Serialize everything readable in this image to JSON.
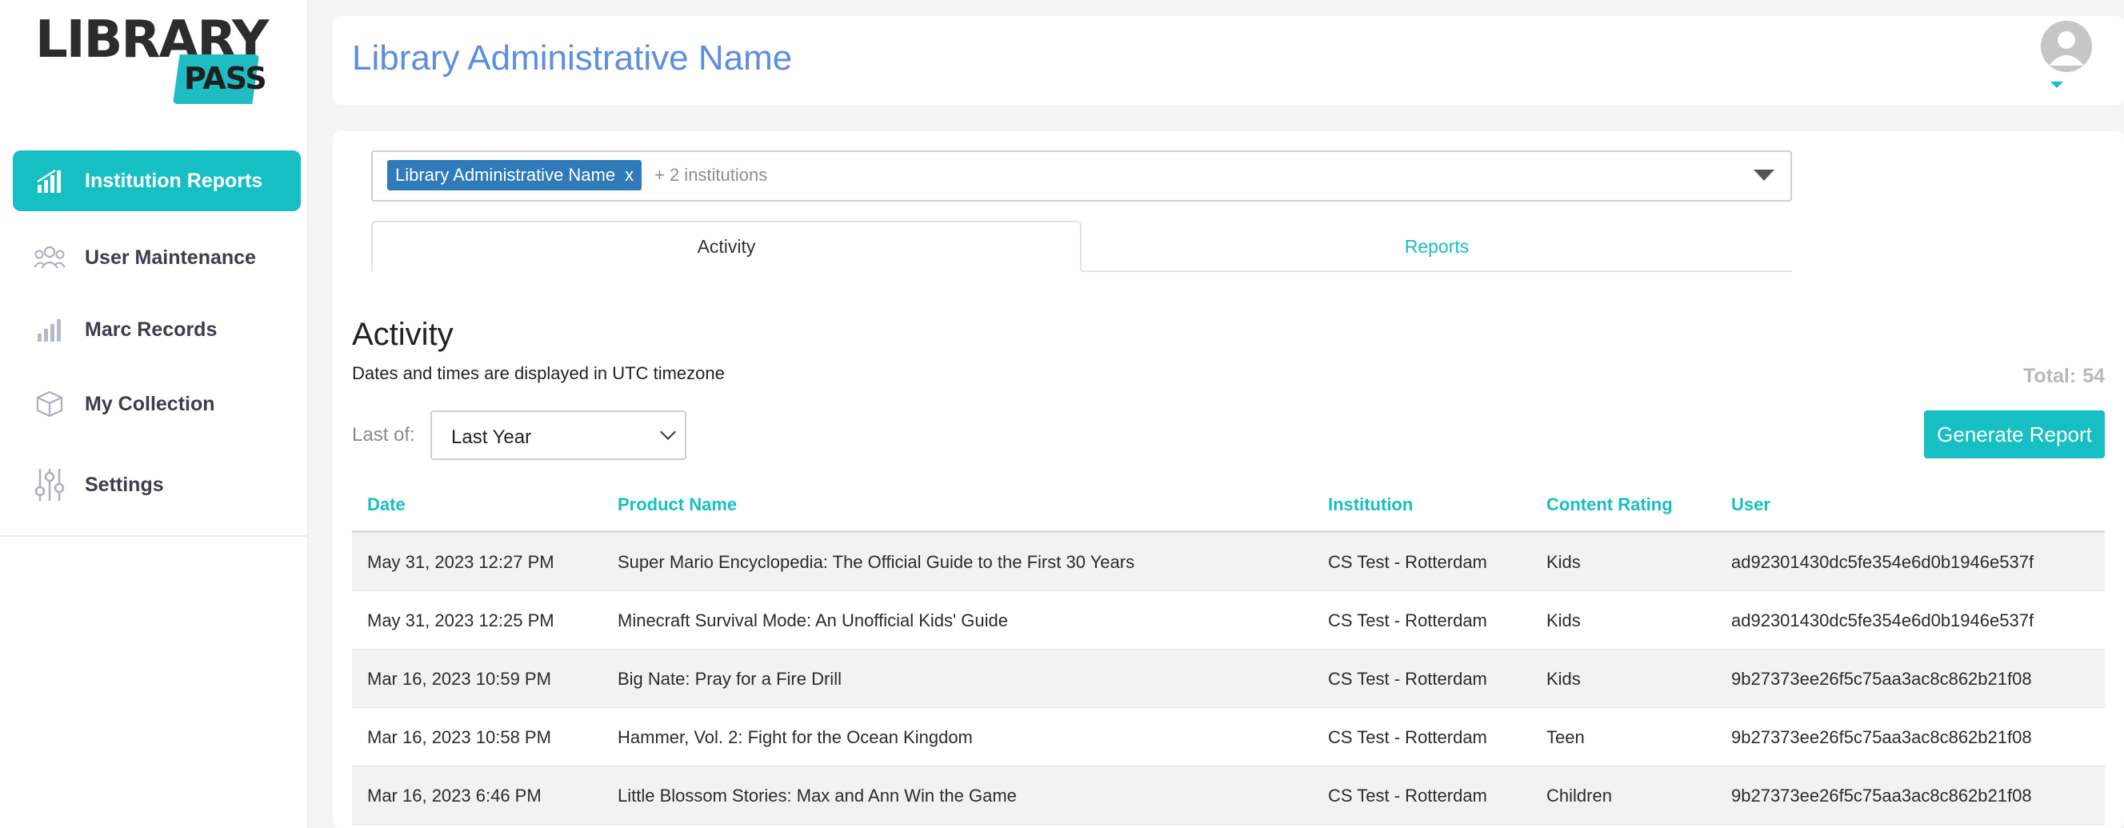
{
  "logo": {
    "word": "LIBRARY",
    "sub": "PASS"
  },
  "sidebar": {
    "items": [
      {
        "label": "Institution Reports",
        "icon": "bar-chart-icon",
        "active": true
      },
      {
        "label": "User Maintenance",
        "icon": "users-icon",
        "active": false
      },
      {
        "label": "Marc Records",
        "icon": "bar-chart-icon",
        "active": false
      },
      {
        "label": "My Collection",
        "icon": "box-icon",
        "active": false
      },
      {
        "label": "Settings",
        "icon": "sliders-icon",
        "active": false
      }
    ]
  },
  "header": {
    "title": "Library Administrative Name",
    "avatar_icon": "user-avatar-icon"
  },
  "institutions": {
    "tag_label": "Library Administrative Name",
    "tag_remove": "x",
    "more": "+ 2 institutions"
  },
  "tabs": [
    {
      "label": "Activity",
      "active": true
    },
    {
      "label": "Reports",
      "active": false
    }
  ],
  "activity": {
    "heading": "Activity",
    "subtitle": "Dates and times are displayed in UTC timezone",
    "total_label": "Total:",
    "total_value": "54",
    "filter_label": "Last of:",
    "filter_value": "Last Year",
    "generate_label": "Generate Report"
  },
  "table": {
    "columns": [
      "Date",
      "Product Name",
      "Institution",
      "Content Rating",
      "User"
    ],
    "rows": [
      [
        "May 31, 2023 12:27 PM",
        "Super Mario Encyclopedia: The Official Guide to the First 30 Years",
        "CS Test - Rotterdam",
        "Kids",
        "ad92301430dc5fe354e6d0b1946e537f"
      ],
      [
        "May 31, 2023 12:25 PM",
        "Minecraft Survival Mode: An Unofficial Kids' Guide",
        "CS Test - Rotterdam",
        "Kids",
        "ad92301430dc5fe354e6d0b1946e537f"
      ],
      [
        "Mar 16, 2023 10:59 PM",
        "Big Nate: Pray for a Fire Drill",
        "CS Test - Rotterdam",
        "Kids",
        "9b27373ee26f5c75aa3ac8c862b21f08"
      ],
      [
        "Mar 16, 2023 10:58 PM",
        "Hammer, Vol. 2: Fight for the Ocean Kingdom",
        "CS Test - Rotterdam",
        "Teen",
        "9b27373ee26f5c75aa3ac8c862b21f08"
      ],
      [
        "Mar 16, 2023 6:46 PM",
        "Little Blossom Stories: Max and Ann Win the Game",
        "CS Test - Rotterdam",
        "Children",
        "9b27373ee26f5c75aa3ac8c862b21f08"
      ]
    ]
  },
  "colors": {
    "accent": "#15bfc4",
    "title": "#5c8ee0",
    "tag": "#2f7ab9"
  }
}
